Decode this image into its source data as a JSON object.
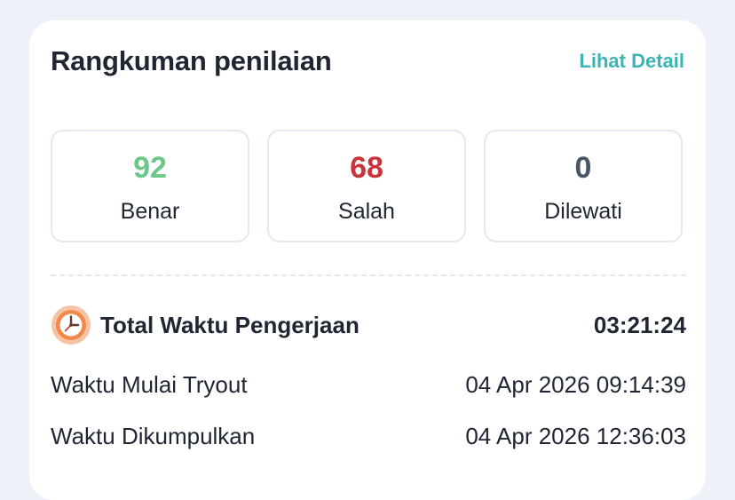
{
  "summary": {
    "title": "Rangkuman penilaian",
    "detail_link": "Lihat Detail"
  },
  "stats": [
    {
      "value": "92",
      "label": "Benar",
      "color": "#6cc88a"
    },
    {
      "value": "68",
      "label": "Salah",
      "color": "#c8343a"
    },
    {
      "value": "0",
      "label": "Dilewati",
      "color": "#4a5466"
    }
  ],
  "time": {
    "icon": "clock-icon",
    "total_label": "Total Waktu Pengerjaan",
    "total_value": "03:21:24",
    "start_label": "Waktu Mulai Tryout",
    "start_value": "04 Apr 2026 09:14:39",
    "submit_label": "Waktu Dikumpulkan",
    "submit_value": "04 Apr 2026 12:36:03"
  },
  "colors": {
    "accent": "#3ab4b4",
    "correct": "#6cc88a",
    "wrong": "#c8343a",
    "skipped": "#4a5466",
    "clock": "#f08a4b"
  }
}
